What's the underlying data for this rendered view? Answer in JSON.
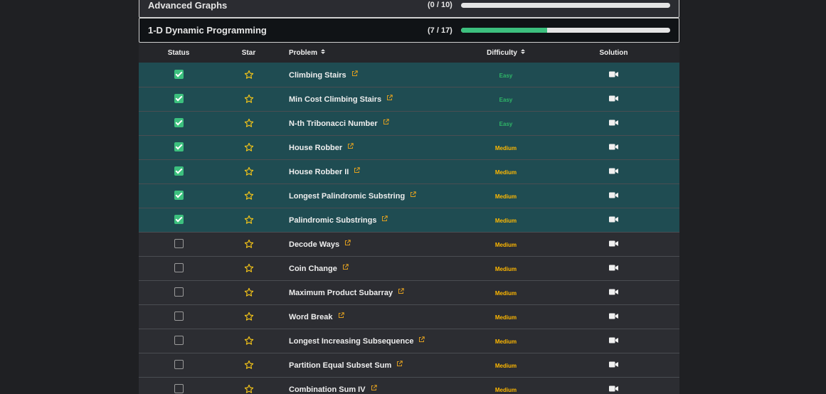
{
  "sections": {
    "advanced_graphs": {
      "title": "Advanced Graphs",
      "count": "(0 / 10)",
      "progress": 0.0
    },
    "dp": {
      "title": "1-D Dynamic Programming",
      "count": "(7 / 17)",
      "progress": 0.412
    }
  },
  "table": {
    "headers": {
      "status": "Status",
      "star": "Star",
      "problem": "Problem",
      "difficulty": "Difficulty",
      "solution": "Solution"
    },
    "rows": [
      {
        "name": "Climbing Stairs",
        "difficulty": "Easy",
        "done": true
      },
      {
        "name": "Min Cost Climbing Stairs",
        "difficulty": "Easy",
        "done": true
      },
      {
        "name": "N-th Tribonacci Number",
        "difficulty": "Easy",
        "done": true
      },
      {
        "name": "House Robber",
        "difficulty": "Medium",
        "done": true
      },
      {
        "name": "House Robber II",
        "difficulty": "Medium",
        "done": true
      },
      {
        "name": "Longest Palindromic Substring",
        "difficulty": "Medium",
        "done": true
      },
      {
        "name": "Palindromic Substrings",
        "difficulty": "Medium",
        "done": true
      },
      {
        "name": "Decode Ways",
        "difficulty": "Medium",
        "done": false
      },
      {
        "name": "Coin Change",
        "difficulty": "Medium",
        "done": false
      },
      {
        "name": "Maximum Product Subarray",
        "difficulty": "Medium",
        "done": false
      },
      {
        "name": "Word Break",
        "difficulty": "Medium",
        "done": false
      },
      {
        "name": "Longest Increasing Subsequence",
        "difficulty": "Medium",
        "done": false
      },
      {
        "name": "Partition Equal Subset Sum",
        "difficulty": "Medium",
        "done": false
      },
      {
        "name": "Combination Sum IV",
        "difficulty": "Medium",
        "done": false
      }
    ]
  },
  "icons": {
    "star": "star-outline-icon",
    "external": "external-link-icon",
    "solution": "video-camera-icon",
    "sort": "sort-icon"
  },
  "colors": {
    "done_row": "#1f4c52",
    "easy": "#2fb567",
    "medium": "#ffb800",
    "star": "#f5c518",
    "progress": "#3cc07e"
  }
}
